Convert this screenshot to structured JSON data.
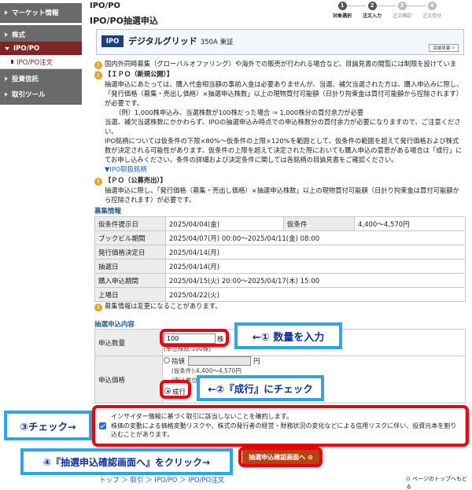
{
  "sidebar": {
    "items": [
      {
        "label": "マーケット情報"
      },
      {
        "label": "株式"
      },
      {
        "label": "IPO/PO"
      },
      {
        "label": "IPO/PO注文"
      },
      {
        "label": "投資信託"
      },
      {
        "label": "取引ツール"
      }
    ]
  },
  "header": {
    "breadcrumb": "IPO/PO",
    "title": "IPO/PO抽選申込",
    "steps": [
      {
        "num": "1",
        "label": "対象選択"
      },
      {
        "num": "2",
        "label": "注文入力"
      },
      {
        "num": "3",
        "label": "注文確認"
      },
      {
        "num": "4",
        "label": "注文受付"
      }
    ]
  },
  "stock": {
    "badge": "IPO",
    "name": "デジタルグリッド",
    "code": "350A 東証",
    "prospectus_label": "目論見書"
  },
  "notices": {
    "global": "国内外同時募集（グローバルオファリング）や海外での販売が行われる場合など、目論見書の閲覧には制限を設けています。",
    "ipo_title": "【ＩＰＯ（新規公開）】",
    "ipo_p1": "抽選申込にあたっては、購入代金相当額の事前入金は必要ありませんが、当選、補欠当選された方は、購入申込みに際し、「発行価格（募集・売出し価格）×抽選申込株数」以上の現物買付可能額（日計り拘束金は買付可能額から控除されます）が必要です。",
    "ipo_example": "（例）1,000株申込み、当選株数が100株だった場合 ⇒ 1,000株分の買付余力が必要",
    "ipo_p2": "当選、補欠当選株数にかかわらず、IPOの抽選申込み時点での申込株数分の買付余力が必要になりますので、ご注意ください。",
    "ipo_p3": "IPO銘柄については仮条件の下限×80%～仮条件の上限×120%を範囲として、仮条件の範囲を超えて発行価格および株式数が決定される可能性があります。仮条件の上限を超えて決定された際においても購入申込の意思がある場合は「成行」にてお申し込みください。条件の詳細および決定条件に関しては各銘柄の目論見書をご確認ください。",
    "ipo_link": "▼IPO取扱銘柄",
    "po_title": "【ＰＯ（公募売出）】",
    "po_p1": "抽選申込に際し、「発行価格（募集・売出し価格）×抽選申込株数」以上の現物買付可能額（日計り拘束金は買付可能額から控除されます）が必要です。"
  },
  "offering": {
    "heading": "募集情報",
    "rows": [
      {
        "label": "仮条件提示日",
        "value": "2025/04/04(金)",
        "label2": "仮条件",
        "value2": "4,400～4,570円"
      },
      {
        "label": "ブックビル期間",
        "value": "2025/04/07(月) 00:00～2025/04/11(金) 08:00"
      },
      {
        "label": "発行価格決定日",
        "value": "2025/04/14(月)"
      },
      {
        "label": "抽選日",
        "value": "2025/04/14(月)"
      },
      {
        "label": "購入申込期間",
        "value": "2025/04/15(火) 20:00～2025/04/17(木) 15:00"
      },
      {
        "label": "上場日",
        "value": "2025/04/22(火)"
      }
    ],
    "note": "募集情報は変更になることがあります。"
  },
  "order": {
    "heading": "抽選申込内容",
    "qty_label": "申込数量",
    "qty_value": "100",
    "qty_unit": "株",
    "qty_unit_note": "(単位株数:100株)",
    "price_label": "申込価格",
    "limit_label": "指値",
    "price_unit": "円",
    "range_note": "(仮条件):4,400～4,570円",
    "unit_note": "(申込単位:10円)",
    "market_label": "成行"
  },
  "confirm": {
    "line1": "インサイダー情報に基づく取引に該当しないことを確約します。",
    "line2": "株価の変動による価格変動リスクや、株式の発行者の経営・財務状況の変化などによる信用リスクに伴い、投資元本を割り込むことがあります。"
  },
  "submit_label": "抽選申込確認画面へ",
  "footer": {
    "breadcrumb": "トップ ＞ 取引 ＞ IPO/PO ＞ IPO/PO注文",
    "to_top": "ページのトップへもどる"
  },
  "annotations": {
    "step1": "←① 数量を入力",
    "step2": "←②『成行』にチェック",
    "step3": "③チェック→",
    "step4": "④『抽選申込確認画面へ』をクリック→"
  },
  "colors": {
    "annotation_red": "#e8000f",
    "annotation_blue": "#2da5e8",
    "annotation_text": "#0f2f9a",
    "submit_button": "#b8420f",
    "sidebar_active": "#7d2424"
  }
}
